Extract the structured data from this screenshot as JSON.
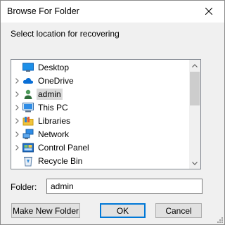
{
  "window": {
    "title": "Browse For Folder"
  },
  "prompt": "Select location for recovering",
  "tree": {
    "items": [
      {
        "label": "Desktop",
        "icon": "desktop-icon",
        "expandable": false,
        "selected": false
      },
      {
        "label": "OneDrive",
        "icon": "cloud-icon",
        "expandable": true,
        "selected": false
      },
      {
        "label": "admin",
        "icon": "user-icon",
        "expandable": true,
        "selected": true
      },
      {
        "label": "This PC",
        "icon": "computer-icon",
        "expandable": true,
        "selected": false
      },
      {
        "label": "Libraries",
        "icon": "libraries-icon",
        "expandable": true,
        "selected": false
      },
      {
        "label": "Network",
        "icon": "network-icon",
        "expandable": true,
        "selected": false
      },
      {
        "label": "Control Panel",
        "icon": "control-panel-icon",
        "expandable": true,
        "selected": false
      },
      {
        "label": "Recycle Bin",
        "icon": "recycle-bin-icon",
        "expandable": false,
        "selected": false
      }
    ]
  },
  "folder": {
    "label": "Folder:",
    "value": "admin"
  },
  "buttons": {
    "new_folder": "Make New Folder",
    "ok": "OK",
    "cancel": "Cancel"
  },
  "colors": {
    "accent": "#0078d7",
    "selection": "#d9d9d9",
    "dialog_bg": "#f0f0f0"
  }
}
